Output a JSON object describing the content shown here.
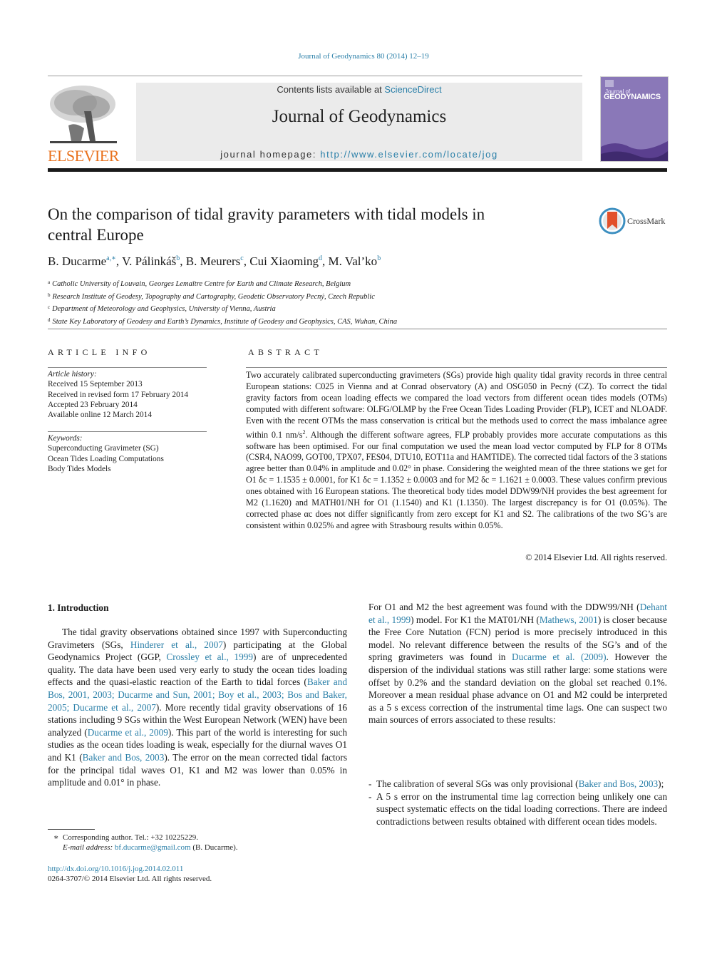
{
  "header": {
    "journal_ref": "Journal of Geodynamics 80 (2014) 12–19",
    "contents_prefix": "Contents lists available at ",
    "contents_link": "ScienceDirect",
    "journal_name": "Journal of Geodynamics",
    "homepage_prefix": "journal homepage: ",
    "homepage_link": "http://www.elsevier.com/locate/jog",
    "publisher": "ELSEVIER",
    "cover_title_small": "Journal of",
    "cover_title": "GEODYNAMICS",
    "colors": {
      "link": "#2a7fa8",
      "elsevier_orange": "#e9711c",
      "cover_purple": "#8a78b8",
      "banner_gray": "#ebebeb"
    }
  },
  "article": {
    "title_line1": "On the comparison of tidal gravity parameters with tidal models in",
    "title_line2": "central Europe",
    "crossmark_label": "CrossMark",
    "authors": [
      {
        "name": "B. Ducarme",
        "sup": "a,∗",
        "sep": ", "
      },
      {
        "name": "V. Pálinkáš",
        "sup": "b",
        "sep": ", "
      },
      {
        "name": "B. Meurers",
        "sup": "c",
        "sep": ", "
      },
      {
        "name": "Cui Xiaoming",
        "sup": "d",
        "sep": ", "
      },
      {
        "name": "M. Val’ko",
        "sup": "b",
        "sep": ""
      }
    ],
    "affiliations": [
      {
        "key": "a",
        "text": "Catholic University of Louvain, Georges Lemaître Centre for Earth and Climate Research, Belgium"
      },
      {
        "key": "b",
        "text": "Research Institute of Geodesy, Topography and Cartography, Geodetic Observatory Pecný, Czech Republic"
      },
      {
        "key": "c",
        "text": "Department of Meteorology and Geophysics, University of Vienna, Austria"
      },
      {
        "key": "d",
        "text": "State Key Laboratory of Geodesy and Earth’s Dynamics, Institute of Geodesy and Geophysics, CAS, Wuhan, China"
      }
    ]
  },
  "article_info": {
    "heading": "ARTICLE INFO",
    "history_label": "Article history:",
    "history": [
      "Received 15 September 2013",
      "Received in revised form 17 February 2014",
      "Accepted 23 February 2014",
      "Available online 12 March 2014"
    ],
    "keywords_label": "Keywords:",
    "keywords": [
      "Superconducting Gravimeter (SG)",
      "Ocean Tides Loading Computations",
      "Body Tides Models"
    ]
  },
  "abstract": {
    "heading": "ABSTRACT",
    "text_part1": "Two accurately calibrated superconducting gravimeters (SGs) provide high quality tidal gravity records in three central European stations: C025 in Vienna and at Conrad observatory (A) and OSG050 in Pecný (CZ). To correct the tidal gravity factors from ocean loading effects we compared the load vectors from different ocean tides models (OTMs) computed with different software: OLFG/OLMP by the Free Ocean Tides Loading Provider (FLP), ICET and NLOADF. Even with the recent OTMs the mass conservation is critical but the methods used to correct the mass imbalance agree within 0.1 nm/s",
    "text_sup": "2",
    "text_part2": ". Although the different software agrees, FLP probably provides more accurate computations as this software has been optimised. For our final computation we used the mean load vector computed by FLP for 8 OTMs (CSR4, NAO99, GOT00, TPX07, FES04, DTU10, EOT11a and HAMTIDE). The corrected tidal factors of the 3 stations agree better than 0.04% in amplitude and 0.02° in phase. Considering the weighted mean of the three stations we get for O1 δc = 1.1535 ± 0.0001, for K1 δc = 1.1352 ± 0.0003 and for M2 δc = 1.1621 ± 0.0003. These values confirm previous ones obtained with 16 European stations. The theoretical body tides model DDW99/NH provides the best agreement for M2 (1.1620) and MATH01/NH for O1 (1.1540) and K1 (1.1350). The largest discrepancy is for O1 (0.05%). The corrected phase αc does not differ significantly from zero except for K1 and S2. The calibrations of the two SG’s are consistent within 0.025% and agree with Strasbourg results within 0.05%.",
    "copyright": "© 2014 Elsevier Ltd. All rights reserved."
  },
  "body": {
    "section_heading": "1.  Introduction",
    "intro": [
      {
        "t": "The tidal gravity observations obtained since 1997 with Superconducting Gravimeters (SGs, "
      },
      {
        "l": "Hinderer et al., 2007"
      },
      {
        "t": ") participating at the Global Geodynamics Project (GGP, "
      },
      {
        "l": "Crossley et al., 1999"
      },
      {
        "t": ") are of unprecedented quality. The data have been used very early to study the ocean tides loading effects and the quasi-elastic reaction of the Earth to tidal forces ("
      },
      {
        "l": "Baker and Bos, 2001, 2003; Ducarme and Sun, 2001; Boy et al., 2003; Bos and Baker, 2005; Ducarme et al., 2007"
      },
      {
        "t": "). More recently tidal gravity observations of 16 stations including 9 SGs within the West European Network (WEN) have been analyzed ("
      },
      {
        "l": "Ducarme et al., 2009"
      },
      {
        "t": "). This part of the world is interesting for such studies as the ocean tides loading is weak, especially for the diurnal waves O1 and K1 ("
      },
      {
        "l": "Baker and Bos, 2003"
      },
      {
        "t": "). The error on the mean corrected tidal factors for the principal tidal waves O1, K1 and M2 was lower than 0.05% in amplitude and 0.01° in phase."
      }
    ],
    "right": [
      {
        "t": "For O1 and M2 the best agreement was found with the DDW99/NH ("
      },
      {
        "l": "Dehant et al., 1999"
      },
      {
        "t": ") model. For K1 the MAT01/NH ("
      },
      {
        "l": "Mathews, 2001"
      },
      {
        "t": ") is closer because the Free Core Nutation (FCN) period is more precisely introduced in this model. No relevant difference between the results of the SG’s and of the spring gravimeters was found in "
      },
      {
        "l": "Ducarme et al. (2009)"
      },
      {
        "t": ". However the dispersion of the individual stations was still rather large: some stations were offset by 0.2% and the standard deviation on the global set reached 0.1%. Moreover a mean residual phase advance on O1 and M2 could be interpreted as a 5 s excess correction of the instrumental time lags. One can suspect two main sources of errors associated to these results:"
      }
    ],
    "bullets": [
      {
        "dash": "-",
        "before": "The calibration of several SGs was only provisional (",
        "link": "Baker and Bos, 2003",
        "after": ");"
      },
      {
        "dash": "-",
        "before": "A 5 s error on the instrumental time lag correction being unlikely one can suspect systematic effects on the tidal loading corrections. There are indeed contradictions between results obtained with different ocean tides models.",
        "link": "",
        "after": ""
      }
    ]
  },
  "footer": {
    "footnote_mark": "∗",
    "footnote_text": "Corresponding author. Tel.: +32 10225229.",
    "email_label": "E-mail address:",
    "email": "bf.ducarme@gmail.com",
    "email_suffix": " (B. Ducarme).",
    "doi": "http://dx.doi.org/10.1016/j.jog.2014.02.011",
    "issn_line": "0264-3707/© 2014 Elsevier Ltd. All rights reserved."
  }
}
